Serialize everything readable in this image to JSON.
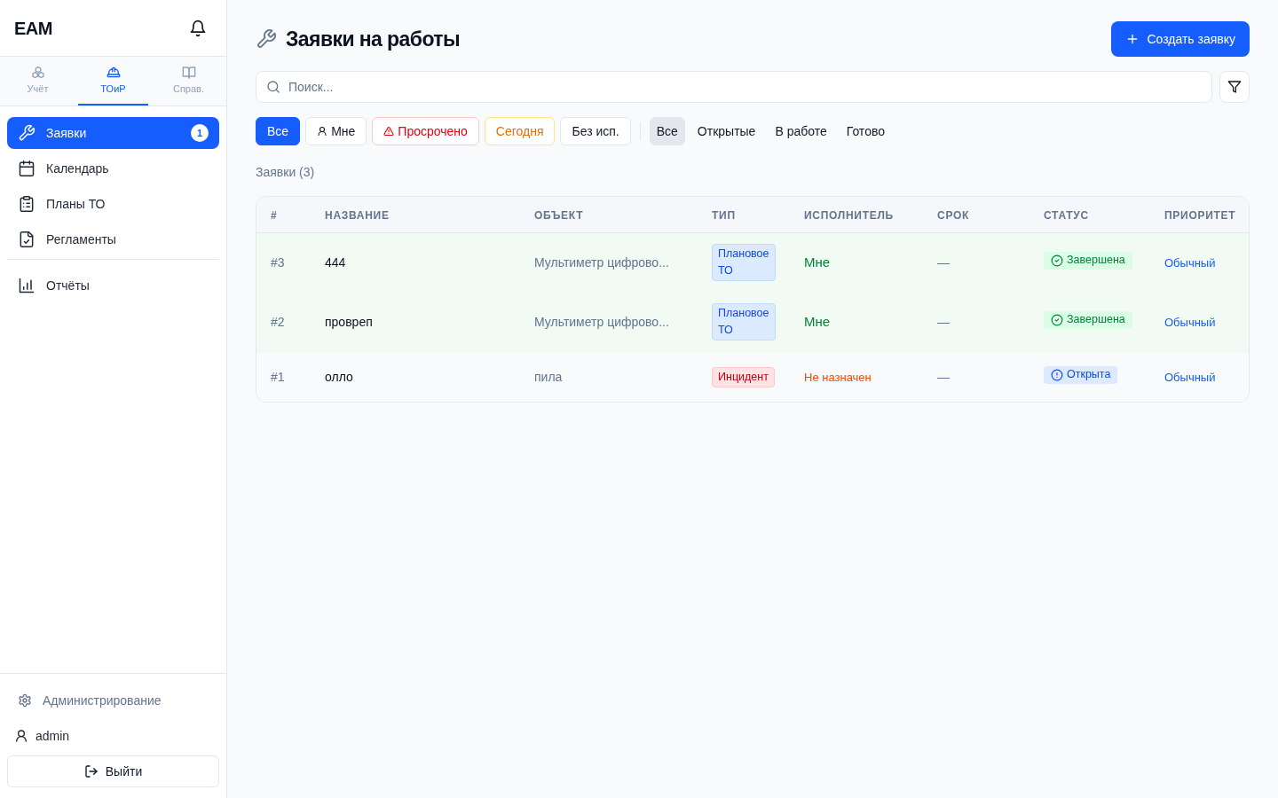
{
  "sidebar": {
    "logo": "EAM",
    "sections": [
      {
        "label": "Учёт",
        "selected": false
      },
      {
        "label": "ТОиР",
        "selected": true
      },
      {
        "label": "Справ.",
        "selected": false
      }
    ],
    "nav_groups": [
      [
        {
          "label": "Заявки",
          "selected": true,
          "badge": "1"
        },
        {
          "label": "Календарь",
          "selected": false
        },
        {
          "label": "Планы ТО",
          "selected": false
        },
        {
          "label": "Регламенты",
          "selected": false
        }
      ],
      [
        {
          "label": "Отчёты",
          "selected": false
        }
      ]
    ],
    "admin_link": "Администрирование",
    "user": "admin",
    "logout_button": "Выйти"
  },
  "header": {
    "title": "Заявки на работы",
    "create_button": "Создать заявку"
  },
  "search": {
    "placeholder": "Поиск..."
  },
  "quick_filters": [
    {
      "label": "Все",
      "kind": "plain",
      "selected": true
    },
    {
      "label": "Мне",
      "kind": "user",
      "selected": false
    },
    {
      "label": "Просрочено",
      "kind": "danger",
      "selected": false
    },
    {
      "label": "Сегодня",
      "kind": "warning",
      "selected": false
    },
    {
      "label": "Без исп.",
      "kind": "plain",
      "selected": false
    }
  ],
  "status_filters": [
    {
      "label": "Все",
      "selected": true
    },
    {
      "label": "Открытые",
      "selected": false
    },
    {
      "label": "В работе",
      "selected": false
    },
    {
      "label": "Готово",
      "selected": false
    }
  ],
  "count_label": "Заявки (3)",
  "table": {
    "columns": [
      "#",
      "НАЗВАНИЕ",
      "ОБЪЕКТ",
      "ТИП",
      "ИСПОЛНИТЕЛЬ",
      "СРОК",
      "СТАТУС",
      "ПРИОРИТЕТ"
    ],
    "rows": [
      {
        "number": "#3",
        "name": "444",
        "object": "Мультиметр цифрово...",
        "type": {
          "label": "Плановое ТО",
          "kind": "planned"
        },
        "assignee": {
          "label": "Мне",
          "kind": "me"
        },
        "due": "—",
        "status": {
          "label": "Завершена",
          "kind": "done"
        },
        "priority": "Обычный"
      },
      {
        "number": "#2",
        "name": "провреп",
        "object": "Мультиметр цифрово...",
        "type": {
          "label": "Плановое ТО",
          "kind": "planned"
        },
        "assignee": {
          "label": "Мне",
          "kind": "me"
        },
        "due": "—",
        "status": {
          "label": "Завершена",
          "kind": "done"
        },
        "priority": "Обычный"
      },
      {
        "number": "#1",
        "name": "олло",
        "object": "пила",
        "type": {
          "label": "Инцидент",
          "kind": "incident"
        },
        "assignee": {
          "label": "Не назначен",
          "kind": "unassigned"
        },
        "due": "—",
        "status": {
          "label": "Открыта",
          "kind": "open"
        },
        "priority": "Обычный"
      }
    ]
  }
}
